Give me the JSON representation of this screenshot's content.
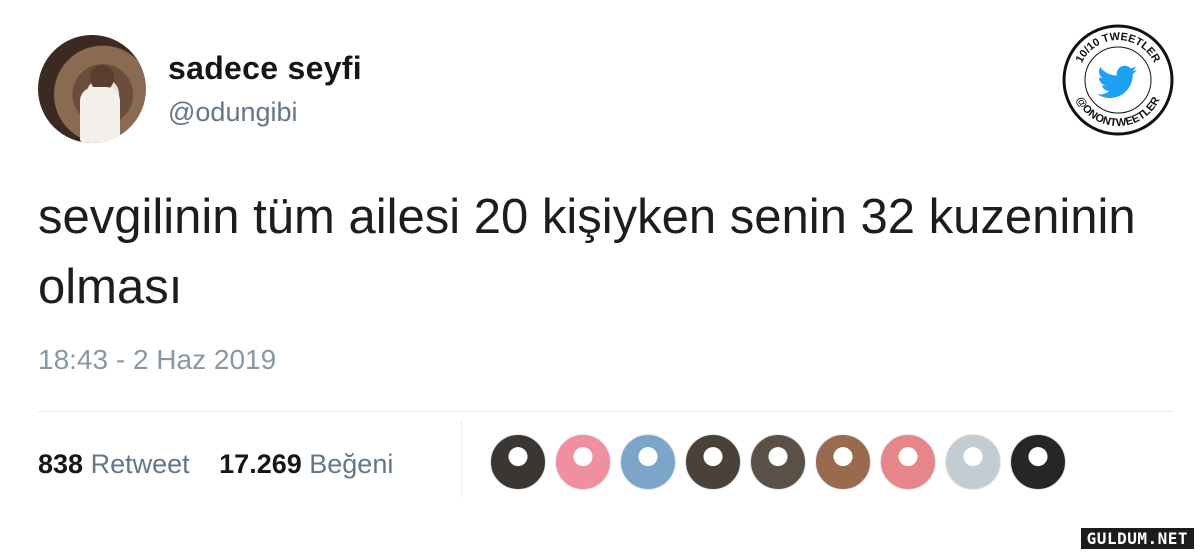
{
  "user": {
    "display_name": "sadece seyfi",
    "handle": "@odungibi"
  },
  "badge": {
    "top_text": "10/10 TWEETLER",
    "bottom_text": "@ONONTWEETLER",
    "icon": "twitter-bird-icon",
    "color": "#1da1f2"
  },
  "tweet": {
    "text": "sevgilinin tüm ailesi 20 kişiyken senin 32 kuzeninin olması",
    "timestamp": "18:43 - 2 Haz 2019"
  },
  "stats": {
    "retweets": {
      "count": "838",
      "label": "Retweet"
    },
    "likes": {
      "count": "17.269",
      "label": "Beğeni"
    }
  },
  "likers": [
    {
      "color": "#3b3632"
    },
    {
      "color": "#f08fa0"
    },
    {
      "color": "#7da5c9"
    },
    {
      "color": "#4a4238"
    },
    {
      "color": "#5b5046"
    },
    {
      "color": "#9a6a4e"
    },
    {
      "color": "#e7868a"
    },
    {
      "color": "#c4ccd3"
    },
    {
      "color": "#262626"
    }
  ],
  "watermark": "GULDUM.NET"
}
